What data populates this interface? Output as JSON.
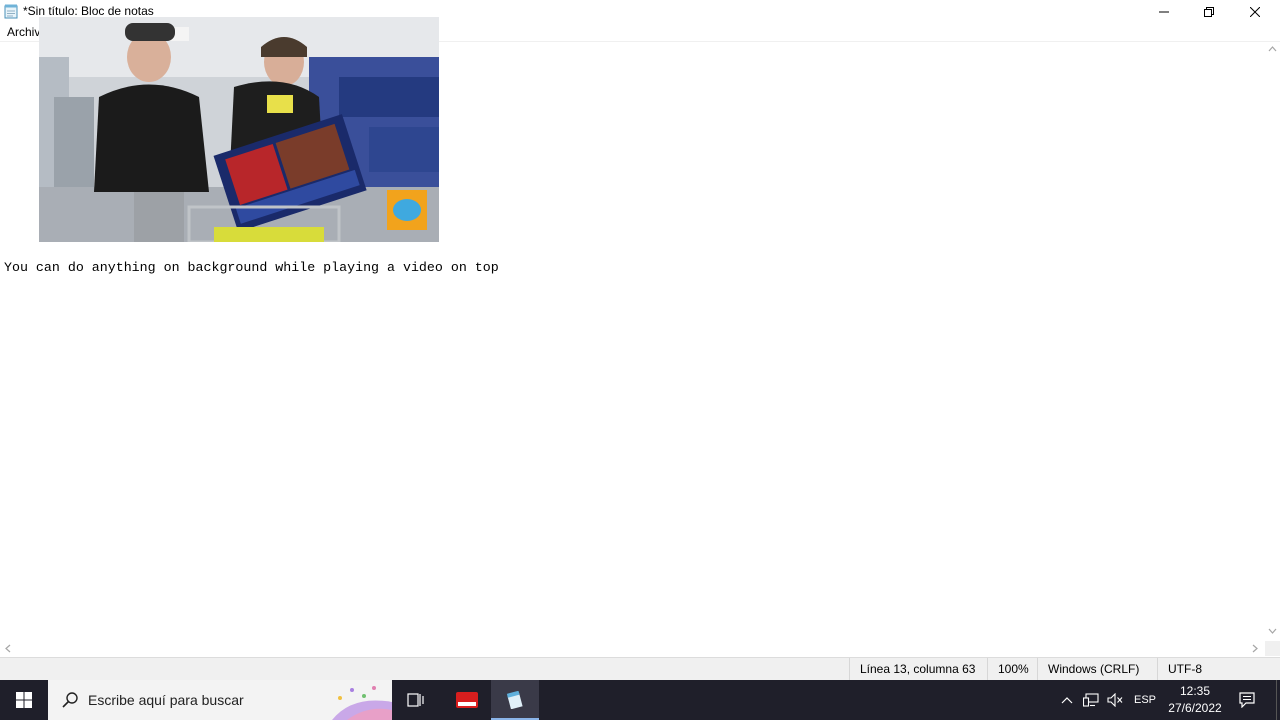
{
  "window": {
    "title": "*Sin título: Bloc de notas"
  },
  "menu": {
    "items": [
      {
        "label": "Archivo"
      }
    ]
  },
  "editor": {
    "content": "You can do anything on background while playing a video on top"
  },
  "statusbar": {
    "position": "Línea 13, columna 63",
    "zoom": "100%",
    "line_ending": "Windows (CRLF)",
    "encoding": "UTF-8"
  },
  "video_overlay": {
    "icon": "mrbeast-logo"
  },
  "taskbar": {
    "search_placeholder": "Escribe aquí para buscar",
    "language": "ESP",
    "time": "12:35",
    "date": "27/6/2022",
    "accent": "#8ab4e8"
  }
}
